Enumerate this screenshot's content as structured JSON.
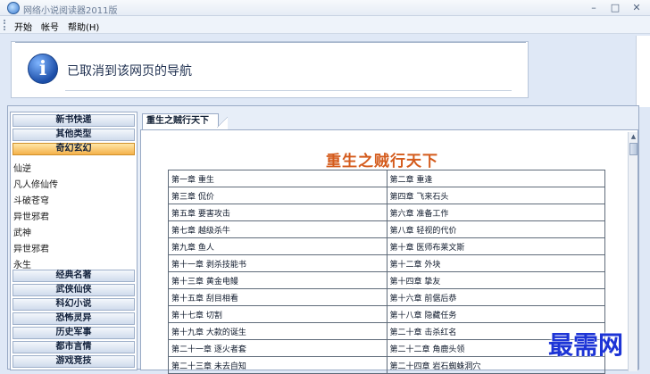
{
  "window": {
    "title": "网络小说阅读器2011版"
  },
  "menu": [
    "开始",
    "帐号",
    "帮助(H)"
  ],
  "info": {
    "message": "已取消到该网页的导航"
  },
  "sidebar": {
    "top_categories": [
      "新书快递",
      "其他类型",
      "奇幻玄幻"
    ],
    "sub_items": [
      "仙逆",
      "凡人修仙传",
      "斗破苍穹",
      "异世邪君",
      "武神",
      "异世邪君",
      "永生"
    ],
    "bottom_categories": [
      "经典名著",
      "武侠仙侠",
      "科幻小说",
      "恐怖灵异",
      "历史军事",
      "都市言情",
      "游戏竞技"
    ]
  },
  "tab": {
    "label": "重生之贼行天下"
  },
  "book": {
    "title": "重生之贼行天下",
    "chapters": [
      [
        "第一章 重生",
        "第二章 重逢"
      ],
      [
        "第三章 侃价",
        "第四章 飞来石头"
      ],
      [
        "第五章 要害攻击",
        "第六章 准备工作"
      ],
      [
        "第七章 越级杀牛",
        "第八章 轻视的代价"
      ],
      [
        "第九章 鱼人",
        "第十章 医师布莱文斯"
      ],
      [
        "第十一章 剥杀技能书",
        "第十二章 外块"
      ],
      [
        "第十三章 黄金电鳗",
        "第十四章 挚友"
      ],
      [
        "第十五章 刮目相看",
        "第十六章 前倨后恭"
      ],
      [
        "第十七章 切割",
        "第十八章 隐藏任务"
      ],
      [
        "第十九章 大款的诞生",
        "第二十章 击杀红名"
      ],
      [
        "第二十一章 逐火者套",
        "第二十二章 角鹿头领"
      ],
      [
        "第二十三章 未去自知",
        "第二十四章 岩石蜘蛛洞穴"
      ]
    ]
  },
  "watermark": "最需网",
  "icons": {
    "app": "app-logo-icon",
    "info": "info-icon"
  },
  "colors": {
    "title": "#d45b1c",
    "active_category": "#f4b14a",
    "watermark": "#1d34d6"
  }
}
